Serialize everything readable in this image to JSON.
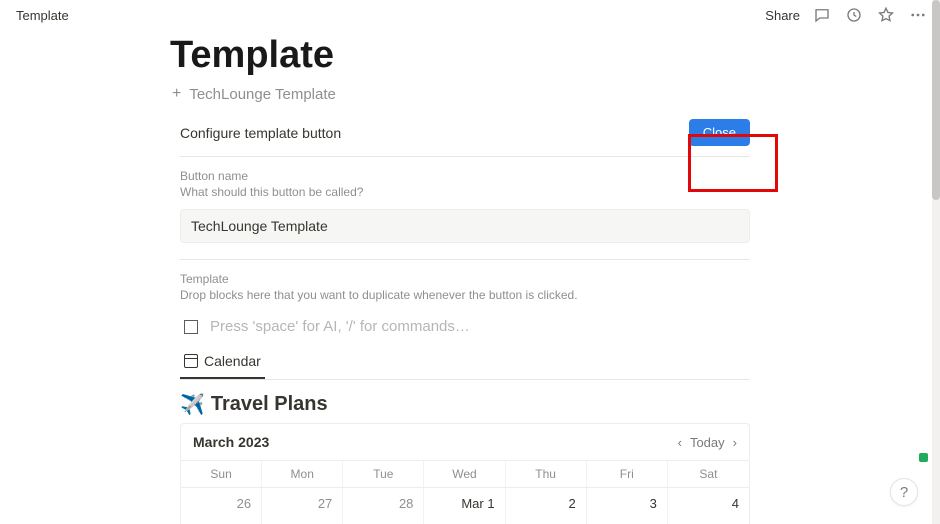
{
  "topbar": {
    "breadcrumb": "Template",
    "share_label": "Share"
  },
  "page": {
    "title": "Template",
    "template_button_label": "TechLounge Template",
    "config_label": "Configure template button",
    "close_label": "Close"
  },
  "form": {
    "name_label": "Button name",
    "name_hint": "What should this button be called?",
    "name_value": "TechLounge Template",
    "template_label": "Template",
    "template_hint": "Drop blocks here that you want to duplicate whenever the button is clicked.",
    "ai_placeholder": "Press 'space' for AI, '/' for commands…"
  },
  "tabs": {
    "calendar_label": "Calendar"
  },
  "view": {
    "title": "Travel Plans"
  },
  "calendar": {
    "month_label": "March 2023",
    "today_label": "Today",
    "weekdays": {
      "sun": "Sun",
      "mon": "Mon",
      "tue": "Tue",
      "wed": "Wed",
      "thu": "Thu",
      "fri": "Fri",
      "sat": "Sat"
    },
    "row1": {
      "d0": "26",
      "d1": "27",
      "d2": "28",
      "d3": "Mar 1",
      "d4": "2",
      "d5": "3",
      "d6": "4"
    }
  },
  "help": {
    "label": "?"
  }
}
